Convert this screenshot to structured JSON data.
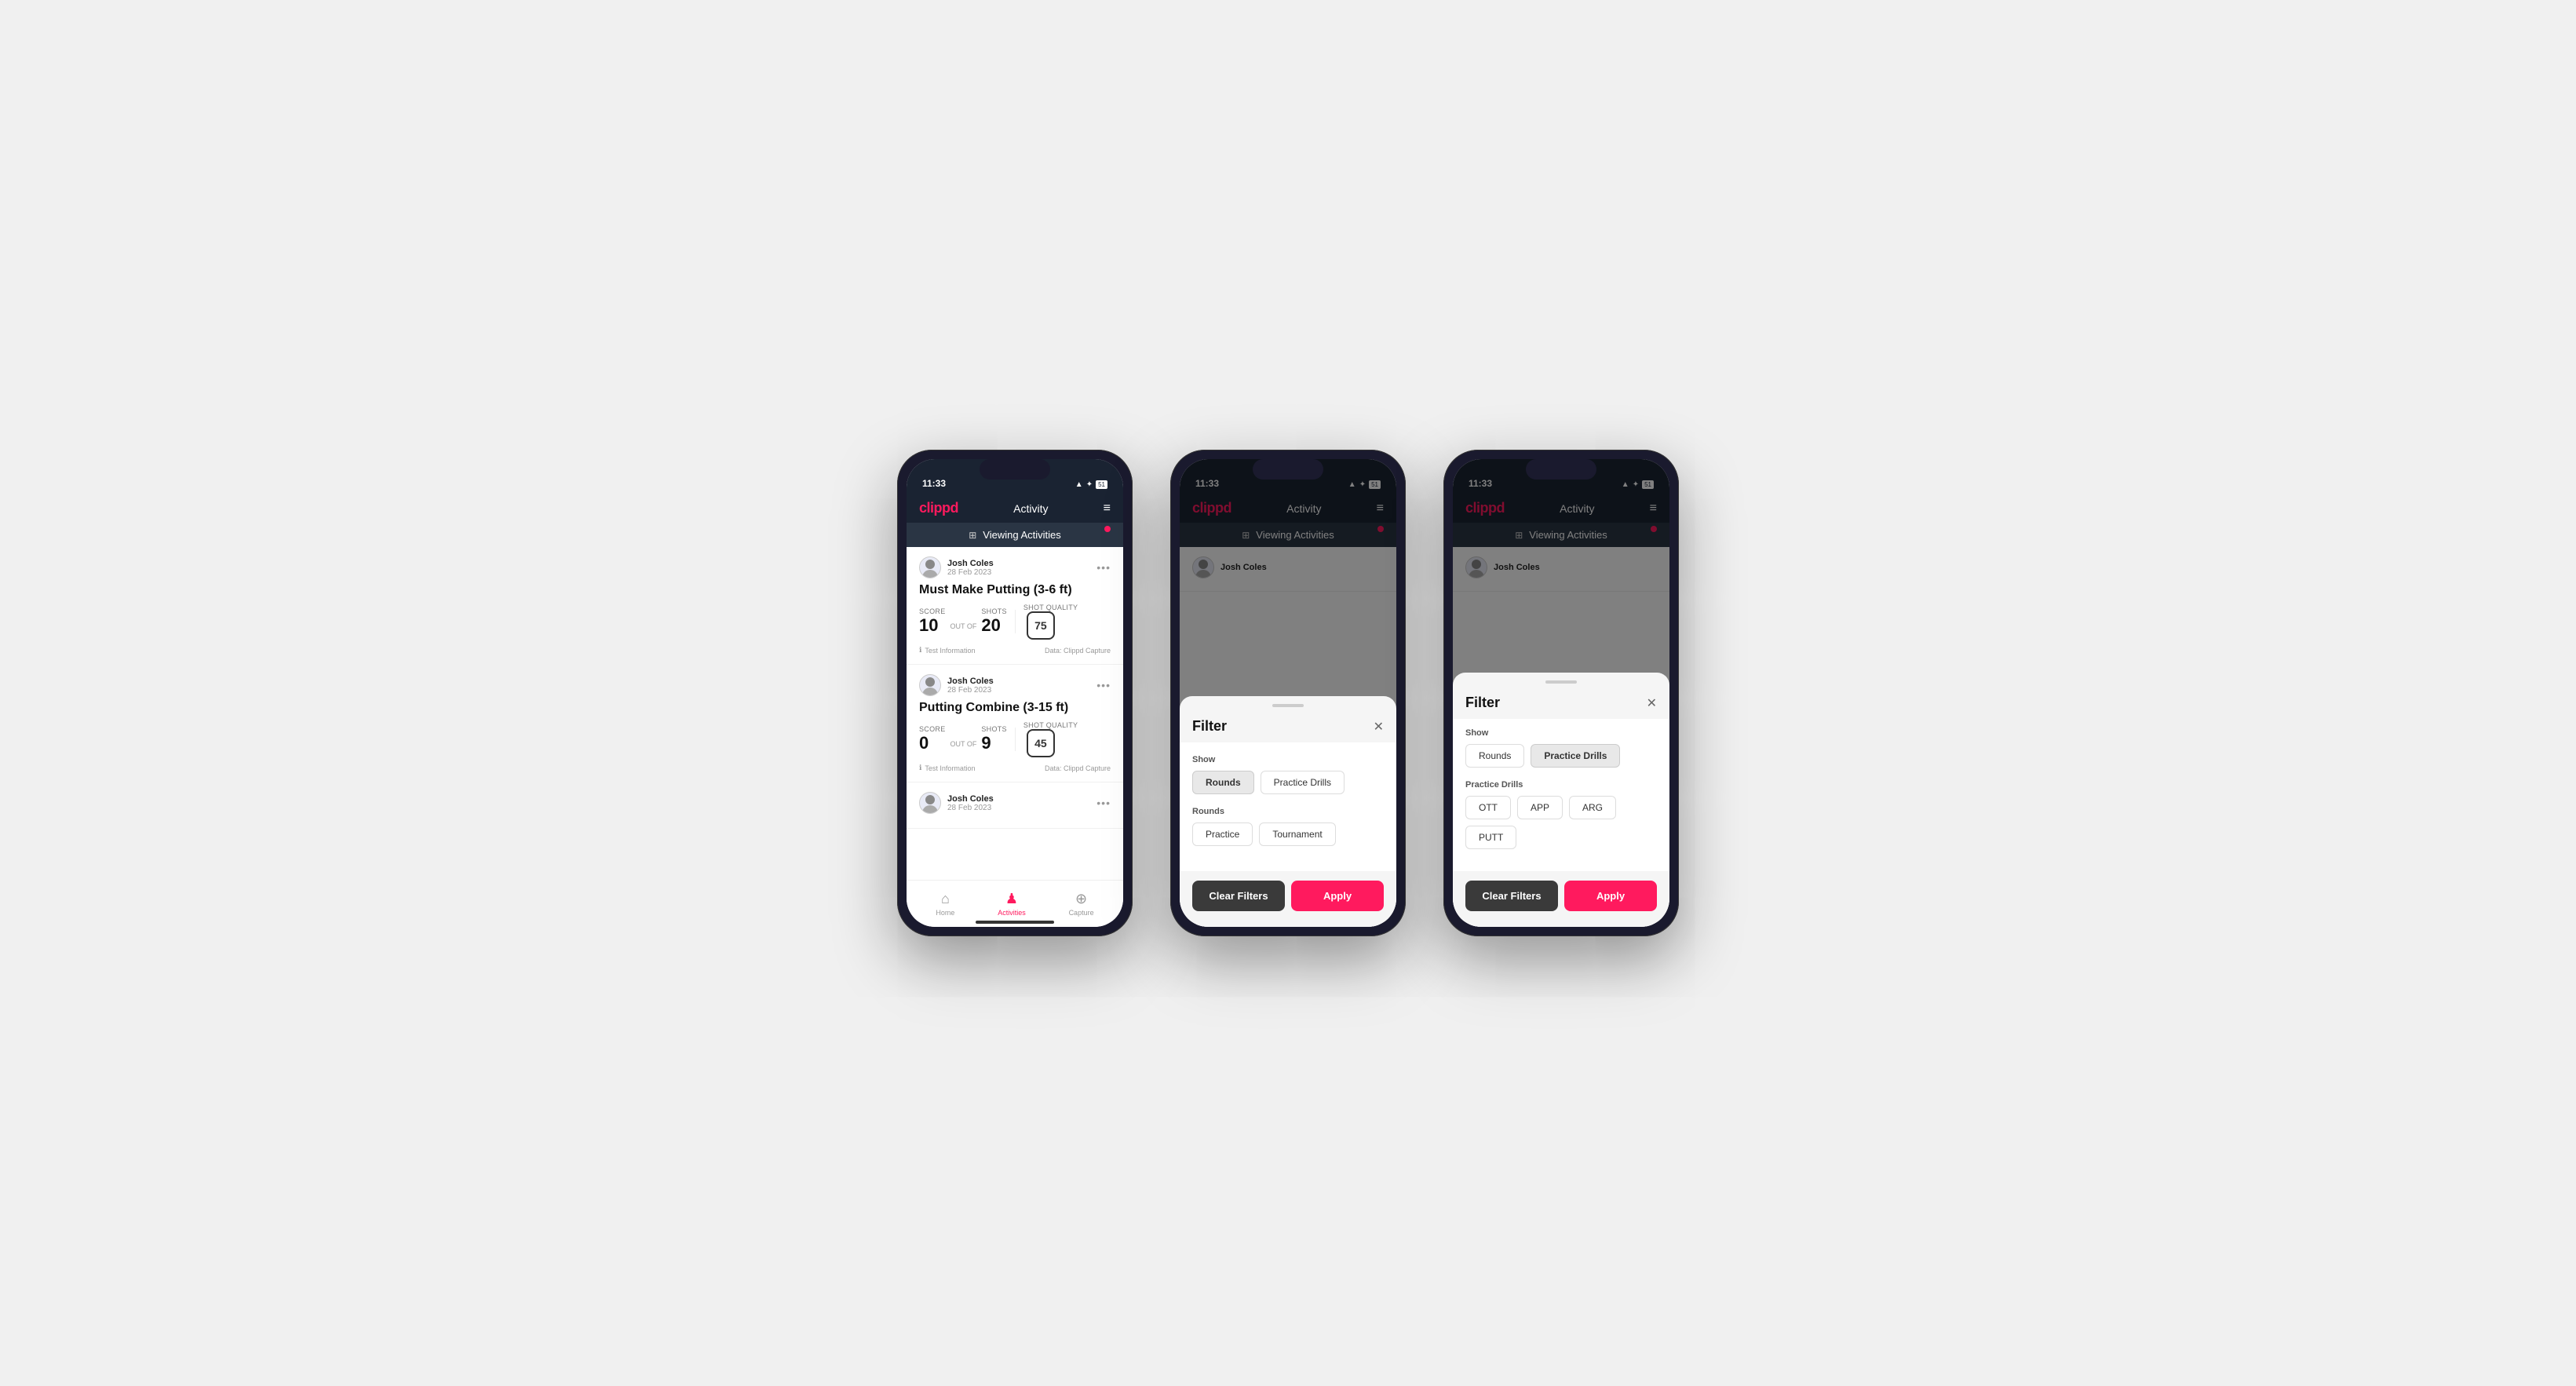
{
  "app": {
    "logo": "clippd",
    "title": "Activity",
    "status_time": "11:33",
    "status_icons": "▲ ✦ ⬛",
    "hamburger": "≡",
    "viewing_banner": "Viewing Activities",
    "filter_icon": "⊞"
  },
  "bottom_nav": {
    "home_label": "Home",
    "activities_label": "Activities",
    "capture_label": "Capture"
  },
  "activities": [
    {
      "user_name": "Josh Coles",
      "user_date": "28 Feb 2023",
      "title": "Must Make Putting (3-6 ft)",
      "score_label": "Score",
      "score": "10",
      "out_of_label": "OUT OF",
      "shots_label": "Shots",
      "shots": "20",
      "shot_quality_label": "Shot Quality",
      "shot_quality": "75",
      "info_text": "Test Information",
      "data_source": "Data: Clippd Capture"
    },
    {
      "user_name": "Josh Coles",
      "user_date": "28 Feb 2023",
      "title": "Putting Combine (3-15 ft)",
      "score_label": "Score",
      "score": "0",
      "out_of_label": "OUT OF",
      "shots_label": "Shots",
      "shots": "9",
      "shot_quality_label": "Shot Quality",
      "shot_quality": "45",
      "info_text": "Test Information",
      "data_source": "Data: Clippd Capture"
    },
    {
      "user_name": "Josh Coles",
      "user_date": "28 Feb 2023",
      "title": "",
      "score_label": "",
      "score": "",
      "shots": "",
      "shot_quality": ""
    }
  ],
  "filter_modal_1": {
    "title": "Filter",
    "close": "✕",
    "show_label": "Show",
    "rounds_chip": "Rounds",
    "practice_drills_chip": "Practice Drills",
    "rounds_section_label": "Rounds",
    "practice_chip": "Practice",
    "tournament_chip": "Tournament",
    "clear_filters_btn": "Clear Filters",
    "apply_btn": "Apply",
    "selected_tab": "Rounds"
  },
  "filter_modal_2": {
    "title": "Filter",
    "close": "✕",
    "show_label": "Show",
    "rounds_chip": "Rounds",
    "practice_drills_chip": "Practice Drills",
    "practice_drills_section_label": "Practice Drills",
    "ott_chip": "OTT",
    "app_chip": "APP",
    "arg_chip": "ARG",
    "putt_chip": "PUTT",
    "clear_filters_btn": "Clear Filters",
    "apply_btn": "Apply",
    "selected_tab": "Practice Drills"
  },
  "colors": {
    "brand_pink": "#ff1a5e",
    "dark_navy": "#1a2332",
    "dark_bg": "#2a3544"
  }
}
